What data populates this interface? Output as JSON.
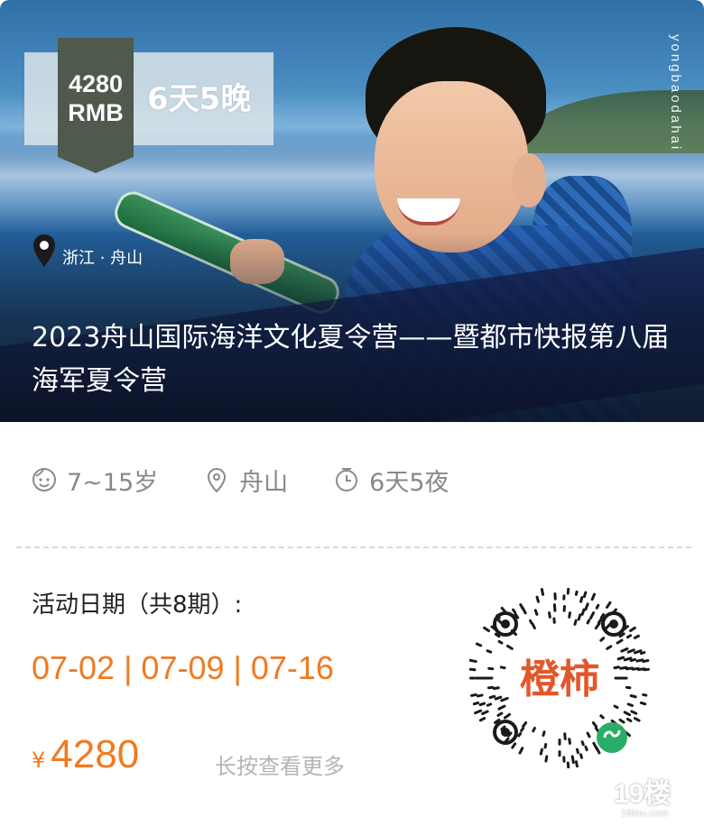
{
  "hero": {
    "price_line1": "4280",
    "price_line2": "RMB",
    "duration": "6天5晚",
    "vertical_text": "yongbaodahai",
    "location": "浙江 · 舟山",
    "title": "2023舟山国际海洋文化夏令营——暨都市快报第八届海军夏令营"
  },
  "info": {
    "age": {
      "icon": "face-icon",
      "text": "7~15岁"
    },
    "place": {
      "icon": "location-pin-icon",
      "text": "舟山"
    },
    "days": {
      "icon": "clock-icon",
      "text": "6天5夜"
    }
  },
  "activity": {
    "dates_label": "活动日期（共8期）:",
    "dates": "07-02 | 07-09 | 07-16",
    "currency": "¥",
    "price": "4280",
    "press_hint": "长按查看更多"
  },
  "qr": {
    "brand_text": "橙柿"
  },
  "logo": {
    "main": "19楼",
    "sub": "19lou.com"
  },
  "colors": {
    "accent": "#f07a1f",
    "muted": "#888888"
  }
}
